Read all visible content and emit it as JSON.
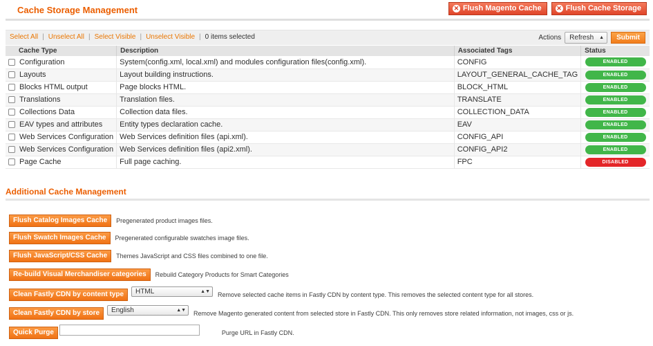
{
  "header": {
    "title": "Cache Storage Management",
    "flush_magento_label": "Flush Magento Cache",
    "flush_storage_label": "Flush Cache Storage"
  },
  "massaction": {
    "select_all": "Select All",
    "unselect_all": "Unselect All",
    "select_visible": "Select Visible",
    "unselect_visible": "Unselect Visible",
    "items_selected": "0 items selected",
    "actions_label": "Actions",
    "action_value": "Refresh",
    "submit_label": "Submit"
  },
  "grid": {
    "columns": [
      "Cache Type",
      "Description",
      "Associated Tags",
      "Status"
    ],
    "rows": [
      {
        "type": "Configuration",
        "description": "System(config.xml, local.xml) and modules configuration files(config.xml).",
        "tags": "CONFIG",
        "status": "ENABLED"
      },
      {
        "type": "Layouts",
        "description": "Layout building instructions.",
        "tags": "LAYOUT_GENERAL_CACHE_TAG",
        "status": "ENABLED"
      },
      {
        "type": "Blocks HTML output",
        "description": "Page blocks HTML.",
        "tags": "BLOCK_HTML",
        "status": "ENABLED"
      },
      {
        "type": "Translations",
        "description": "Translation files.",
        "tags": "TRANSLATE",
        "status": "ENABLED"
      },
      {
        "type": "Collections Data",
        "description": "Collection data files.",
        "tags": "COLLECTION_DATA",
        "status": "ENABLED"
      },
      {
        "type": "EAV types and attributes",
        "description": "Entity types declaration cache.",
        "tags": "EAV",
        "status": "ENABLED"
      },
      {
        "type": "Web Services Configuration",
        "description": "Web Services definition files (api.xml).",
        "tags": "CONFIG_API",
        "status": "ENABLED"
      },
      {
        "type": "Web Services Configuration",
        "description": "Web Services definition files (api2.xml).",
        "tags": "CONFIG_API2",
        "status": "ENABLED"
      },
      {
        "type": "Page Cache",
        "description": "Full page caching.",
        "tags": "FPC",
        "status": "DISABLED"
      }
    ]
  },
  "additional": {
    "title": "Additional Cache Management",
    "items": [
      {
        "button": "Flush Catalog Images Cache",
        "description": "Pregenerated product images files."
      },
      {
        "button": "Flush Swatch Images Cache",
        "description": "Pregenerated configurable swatches image files."
      },
      {
        "button": "Flush JavaScript/CSS Cache",
        "description": "Themes JavaScript and CSS files combined to one file."
      },
      {
        "button": "Re-build Visual Merchandiser categories",
        "description": "Rebuild Category Products for Smart Categories"
      },
      {
        "button": "Clean Fastly CDN by content type",
        "select": "HTML",
        "description": "Remove selected cache items in Fastly CDN by content type. This removes the selected content type for all stores."
      },
      {
        "button": "Clean Fastly CDN by store",
        "select": "English",
        "description": "Remove Magento generated content from selected store in Fastly CDN. This only removes store related information, not images, css or js."
      },
      {
        "button": "Quick Purge",
        "input_value": "",
        "description": "Purge URL in Fastly CDN."
      }
    ]
  },
  "colors": {
    "accent": "#eb5e00",
    "enabled": "#41b649",
    "disabled": "#e42629"
  }
}
